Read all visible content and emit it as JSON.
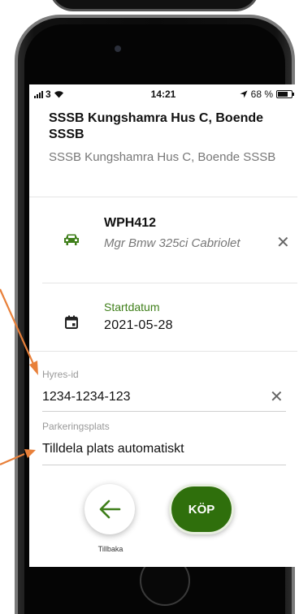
{
  "status_bar": {
    "carrier": "3",
    "time": "14:21",
    "battery": "68 %"
  },
  "header": {
    "title": "SSSB Kungshamra Hus C, Boende SSSB",
    "subtitle": "SSSB Kungshamra Hus C, Boende SSSB"
  },
  "vehicle": {
    "registration": "WPH412",
    "model": "Mgr Bmw 325ci Cabriolet",
    "icon": "car-icon",
    "clear_symbol": "✕"
  },
  "start": {
    "label": "Startdatum",
    "value": "2021-05-28",
    "icon": "calendar-icon"
  },
  "hyres": {
    "label": "Hyres-id",
    "value": "1234-1234-123",
    "clear_symbol": "✕"
  },
  "parking": {
    "label": "Parkeringsplats",
    "value": "Tilldela plats automatiskt"
  },
  "actions": {
    "back_label": "Tillbaka",
    "buy_label": "KÖP"
  },
  "colors": {
    "accent": "#3f7f1a",
    "buy_button": "#2f6f0c",
    "annotation_arrow": "#e8803a"
  }
}
